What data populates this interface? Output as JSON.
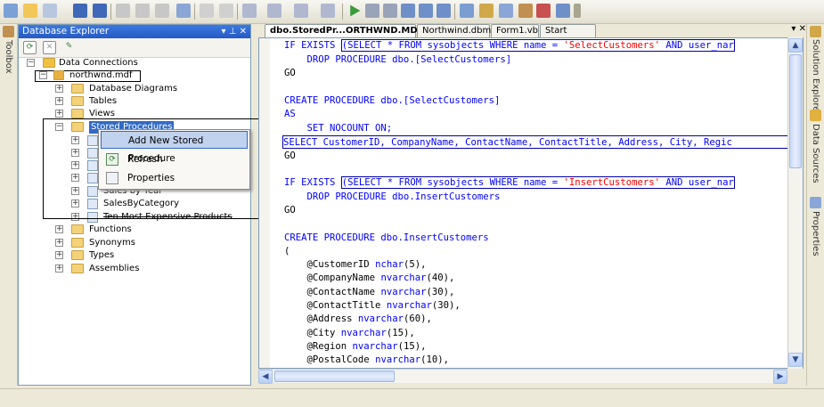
{
  "left_sidebar": {
    "toolbox_label": "Toolbox"
  },
  "db_explorer": {
    "title": "Database Explorer",
    "pin_label": "▾ ⊥ ✕",
    "tree": {
      "data_connections": "Data Connections",
      "connection": "northwnd.mdf",
      "database_diagrams": "Database Diagrams",
      "tables": "Tables",
      "views": "Views",
      "stored_procedures": "Stored Procedures",
      "sales_by_year": "Sales by Year",
      "sales_by_category": "SalesByCategory",
      "ten_most_expensive": "Ten Most Expensive Products",
      "functions": "Functions",
      "synonyms": "Synonyms",
      "types": "Types",
      "assemblies": "Assemblies"
    }
  },
  "context_menu": {
    "add_new": "Add New Stored Procedure",
    "refresh": "Refresh",
    "properties": "Properties"
  },
  "doc_tabs": {
    "active": "dbo.StoredPr...ORTHWND.MDF)*",
    "dbml": "Northwind.dbml",
    "form": "Form1.vb",
    "start": "Start Page",
    "controls": "▾ ✕"
  },
  "right_sidebar": {
    "solution_explorer": "Solution Explorer",
    "data_sources": "Data Sources",
    "properties": "Properties"
  },
  "code": {
    "l1a": "IF EXISTS ",
    "l1b": "(SELECT * FROM sysobjects WHERE name = ",
    "l1c": "'SelectCustomers'",
    "l1d": " AND user_nar",
    "l2": "    DROP PROCEDURE dbo.[SelectCustomers]",
    "l3": "GO",
    "l4": "CREATE PROCEDURE dbo.[SelectCustomers]",
    "l5": "AS",
    "l6": "    SET NOCOUNT ON;",
    "l7": "SELECT CustomerID, CompanyName, ContactName, ContactTitle, Address, City, Regic",
    "l8": "GO",
    "l9a": "IF EXISTS ",
    "l9b": "(SELECT * FROM sysobjects WHERE name = ",
    "l9c": "'InsertCustomers'",
    "l9d": " AND user_nar",
    "l10": "    DROP PROCEDURE dbo.InsertCustomers",
    "l11": "GO",
    "l12": "CREATE PROCEDURE dbo.InsertCustomers",
    "l13": "(",
    "p1a": "    @CustomerID ",
    "p1b": "nchar",
    "p1c": "(5),",
    "p2a": "    @CompanyName ",
    "p2b": "nvarchar",
    "p2c": "(40),",
    "p3a": "    @ContactName ",
    "p3b": "nvarchar",
    "p3c": "(30),",
    "p4a": "    @ContactTitle ",
    "p4b": "nvarchar",
    "p4c": "(30),",
    "p5a": "    @Address ",
    "p5b": "nvarchar",
    "p5c": "(60),",
    "p6a": "    @City ",
    "p6b": "nvarchar",
    "p6c": "(15),",
    "p7a": "    @Region ",
    "p7b": "nvarchar",
    "p7c": "(15),",
    "p8a": "    @PostalCode ",
    "p8b": "nvarchar",
    "p8c": "(10),"
  },
  "scroll": {
    "up": "▲",
    "down": "▼",
    "left": "◀",
    "right": "▶"
  }
}
